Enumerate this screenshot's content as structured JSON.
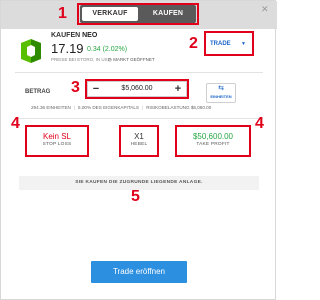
{
  "tabs": [
    {
      "label": "VERKAUF",
      "active": true
    },
    {
      "label": "KAUFEN",
      "active": false
    }
  ],
  "close_glyph": "✕",
  "callouts": [
    "1",
    "2",
    "3",
    "4",
    "4",
    "5"
  ],
  "instrument": {
    "action": "KAUFEN",
    "symbol": "NEO",
    "price": "17.19",
    "change": "0.34 (2.02%)",
    "price_note": "PREISE BEI ETORO, IN USD",
    "market_status": "MARKT GEÖFFNET",
    "logo_icon": "neo-logo-icon",
    "accent_color": "#27a744"
  },
  "trade_dropdown": {
    "label": "TRADE",
    "caret": "▼"
  },
  "amount": {
    "label": "BETRAG",
    "value": "$5,060.00",
    "minus": "−",
    "plus": "+",
    "units_icon": "⇆",
    "units_label": "EINHEITEN"
  },
  "stats": {
    "units": "294.36 EINHEITEN",
    "equity": "5.00% DES EIGENKAPITALS",
    "risk": "RISIKOBELASTUNG $5,060.00"
  },
  "stop_loss": {
    "value": "Kein SL",
    "label": "STOP LOSS",
    "color": "#e0001b"
  },
  "leverage": {
    "value": "X1",
    "label": "HEBEL"
  },
  "take_profit": {
    "value": "$50,600.00",
    "label": "TAKE PROFIT",
    "color": "#27a744"
  },
  "info_text": "SIE KAUFEN DIE ZUGRUNDE LIEGENDE ANLAGE.",
  "submit": {
    "label": "Trade eröffnen",
    "color": "#2c8fe0"
  }
}
